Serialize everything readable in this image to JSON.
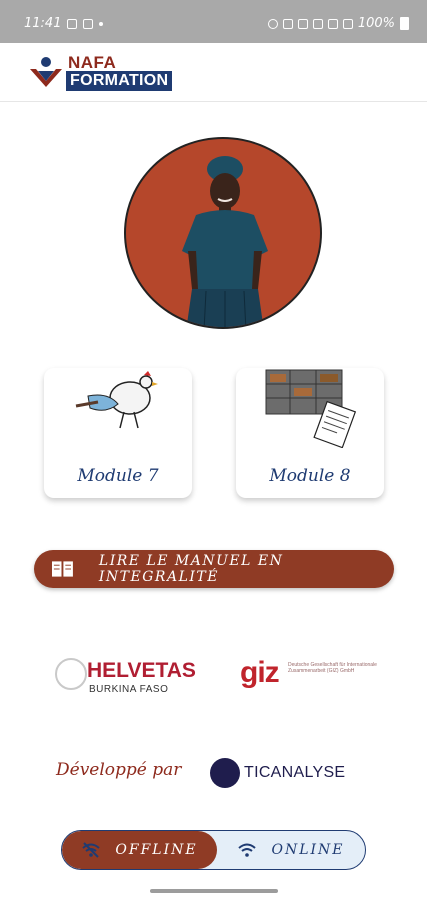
{
  "status_bar": {
    "time": "11:41",
    "battery": "100%",
    "icons": [
      "gallery-icon",
      "notification-icon",
      "alarm-icon",
      "bluetooth-icon",
      "mute-icon",
      "wifi-icon",
      "signal-icon",
      "signal-icon",
      "battery-icon"
    ]
  },
  "header": {
    "logo_line1": "NAFA",
    "logo_line2": "FORMATION"
  },
  "modules": [
    {
      "label": "Module 7",
      "icon": "chicken-icon"
    },
    {
      "label": "Module 8",
      "icon": "warehouse-icon"
    }
  ],
  "manual_button": {
    "label": "LIRE LE MANUEL EN INTEGRALITÉ"
  },
  "partners": {
    "helvetas_name": "HELVETAS",
    "helvetas_sub": "BURKINA FASO",
    "giz_name": "giz",
    "giz_sub": "Deutsche Gesellschaft für Internationale Zusammenarbeit (GIZ) GmbH"
  },
  "developer": {
    "label": "Développé par",
    "company": "TICANALYSE"
  },
  "mode_toggle": {
    "offline_label": "OFFLINE",
    "online_label": "ONLINE",
    "selected": "OFFLINE"
  },
  "colors": {
    "brand_brown": "#8f3b25",
    "brand_navy": "#1f3b72",
    "status_bar": "#a9a9a9"
  }
}
